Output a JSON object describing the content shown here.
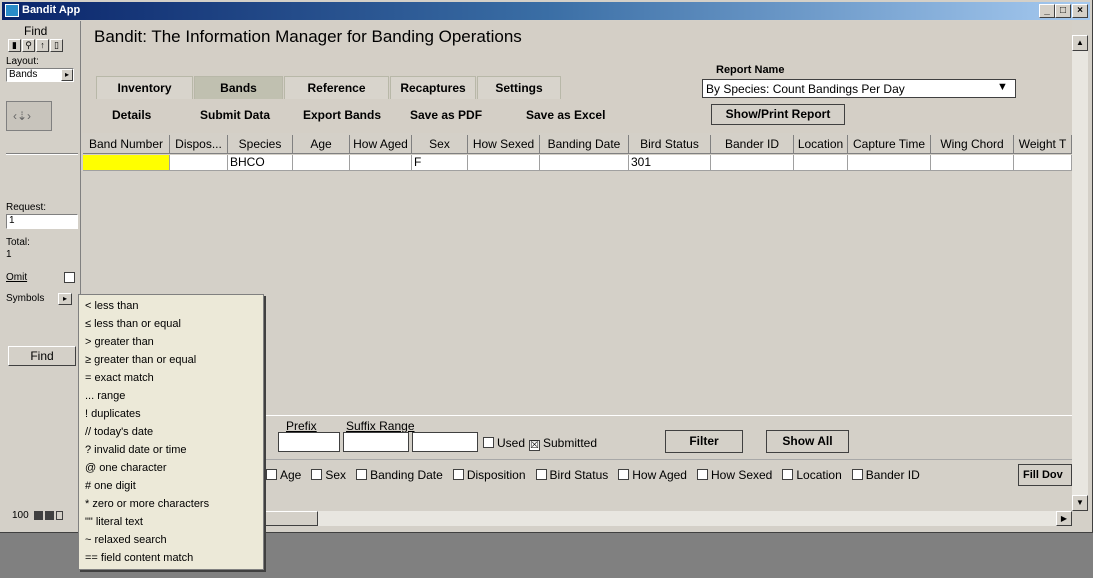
{
  "window": {
    "title": "Bandit App"
  },
  "status": {
    "find_label": "Find",
    "layout_label": "Layout:",
    "layout_value": "Bands",
    "request_label": "Request:",
    "request_value": "1",
    "total_label": "Total:",
    "total_value": "1",
    "omit_label": "Omit",
    "symbols_label": "Symbols",
    "find_button": "Find",
    "zoom": "100"
  },
  "header": {
    "title": "Bandit: The Information Manager for Banding Operations",
    "tabs": [
      "Inventory",
      "Bands",
      "Reference",
      "Recaptures",
      "Settings"
    ],
    "links": [
      "Details",
      "Submit Data",
      "Export Bands",
      "Save as PDF",
      "Save as Excel"
    ],
    "report_name_label": "Report Name",
    "report_value": "By Species: Count Bandings Per Day",
    "show_print_report": "Show/Print Report"
  },
  "table": {
    "columns": [
      "Band Number",
      "Dispos...",
      "Species",
      "Age",
      "How Aged",
      "Sex",
      "How Sexed",
      "Banding Date",
      "Bird Status",
      "Bander ID",
      "Location",
      "Capture Time",
      "Wing Chord",
      "Weight T"
    ],
    "row": [
      "",
      "",
      "BHCO",
      "",
      "",
      "F",
      "",
      "",
      "301",
      "",
      "",
      "",
      "",
      ""
    ]
  },
  "filter": {
    "prefix_label": "Prefix",
    "suffix_range_label": "Suffix Range",
    "used_label": "Used",
    "submitted_label": "Submitted",
    "submitted_checked": true,
    "filter_button": "Filter",
    "show_all_button": "Show All"
  },
  "fill": {
    "checkboxes": [
      "Age",
      "Sex",
      "Banding Date",
      "Disposition",
      "Bird Status",
      "How Aged",
      "How Sexed",
      "Location",
      "Bander ID"
    ],
    "fill_button": "Fill Dov"
  },
  "symbols_menu": [
    "<  less than",
    "≤ less than or equal",
    ">  greater than",
    "≥ greater than or equal",
    "=  exact match",
    "... range",
    "!  duplicates",
    "// today's date",
    "?  invalid date or time",
    "@  one character",
    "#  one digit",
    "*  zero or more characters",
    "\"\" literal text",
    "~  relaxed search",
    "== field content match"
  ]
}
